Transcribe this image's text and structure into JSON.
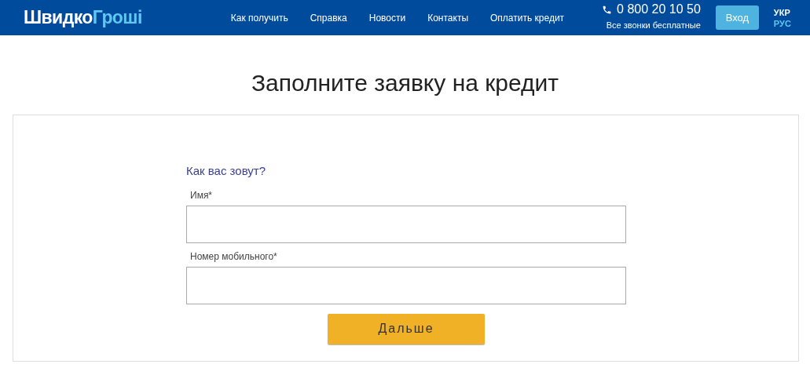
{
  "header": {
    "logo": {
      "part_1": "Швидко",
      "part_2": "Гроші"
    },
    "nav": [
      "Как получить",
      "Справка",
      "Новости",
      "Контакты",
      "Оплатить кредит"
    ],
    "phone": {
      "number": "0 800 20 10 50",
      "note": "Все звонки бесплатные"
    },
    "login_button": "Вход",
    "languages": [
      {
        "label": "УКР",
        "selected": false
      },
      {
        "label": "РУС",
        "selected": true
      }
    ]
  },
  "page_title": "Заполните заявку на кредит",
  "form": {
    "heading": "Как вас зовут?",
    "fields": [
      {
        "label": "Имя",
        "required_mark": "*"
      },
      {
        "label": "Номер мобильного",
        "required_mark": "*"
      }
    ],
    "submit_button": "Дальше"
  }
}
